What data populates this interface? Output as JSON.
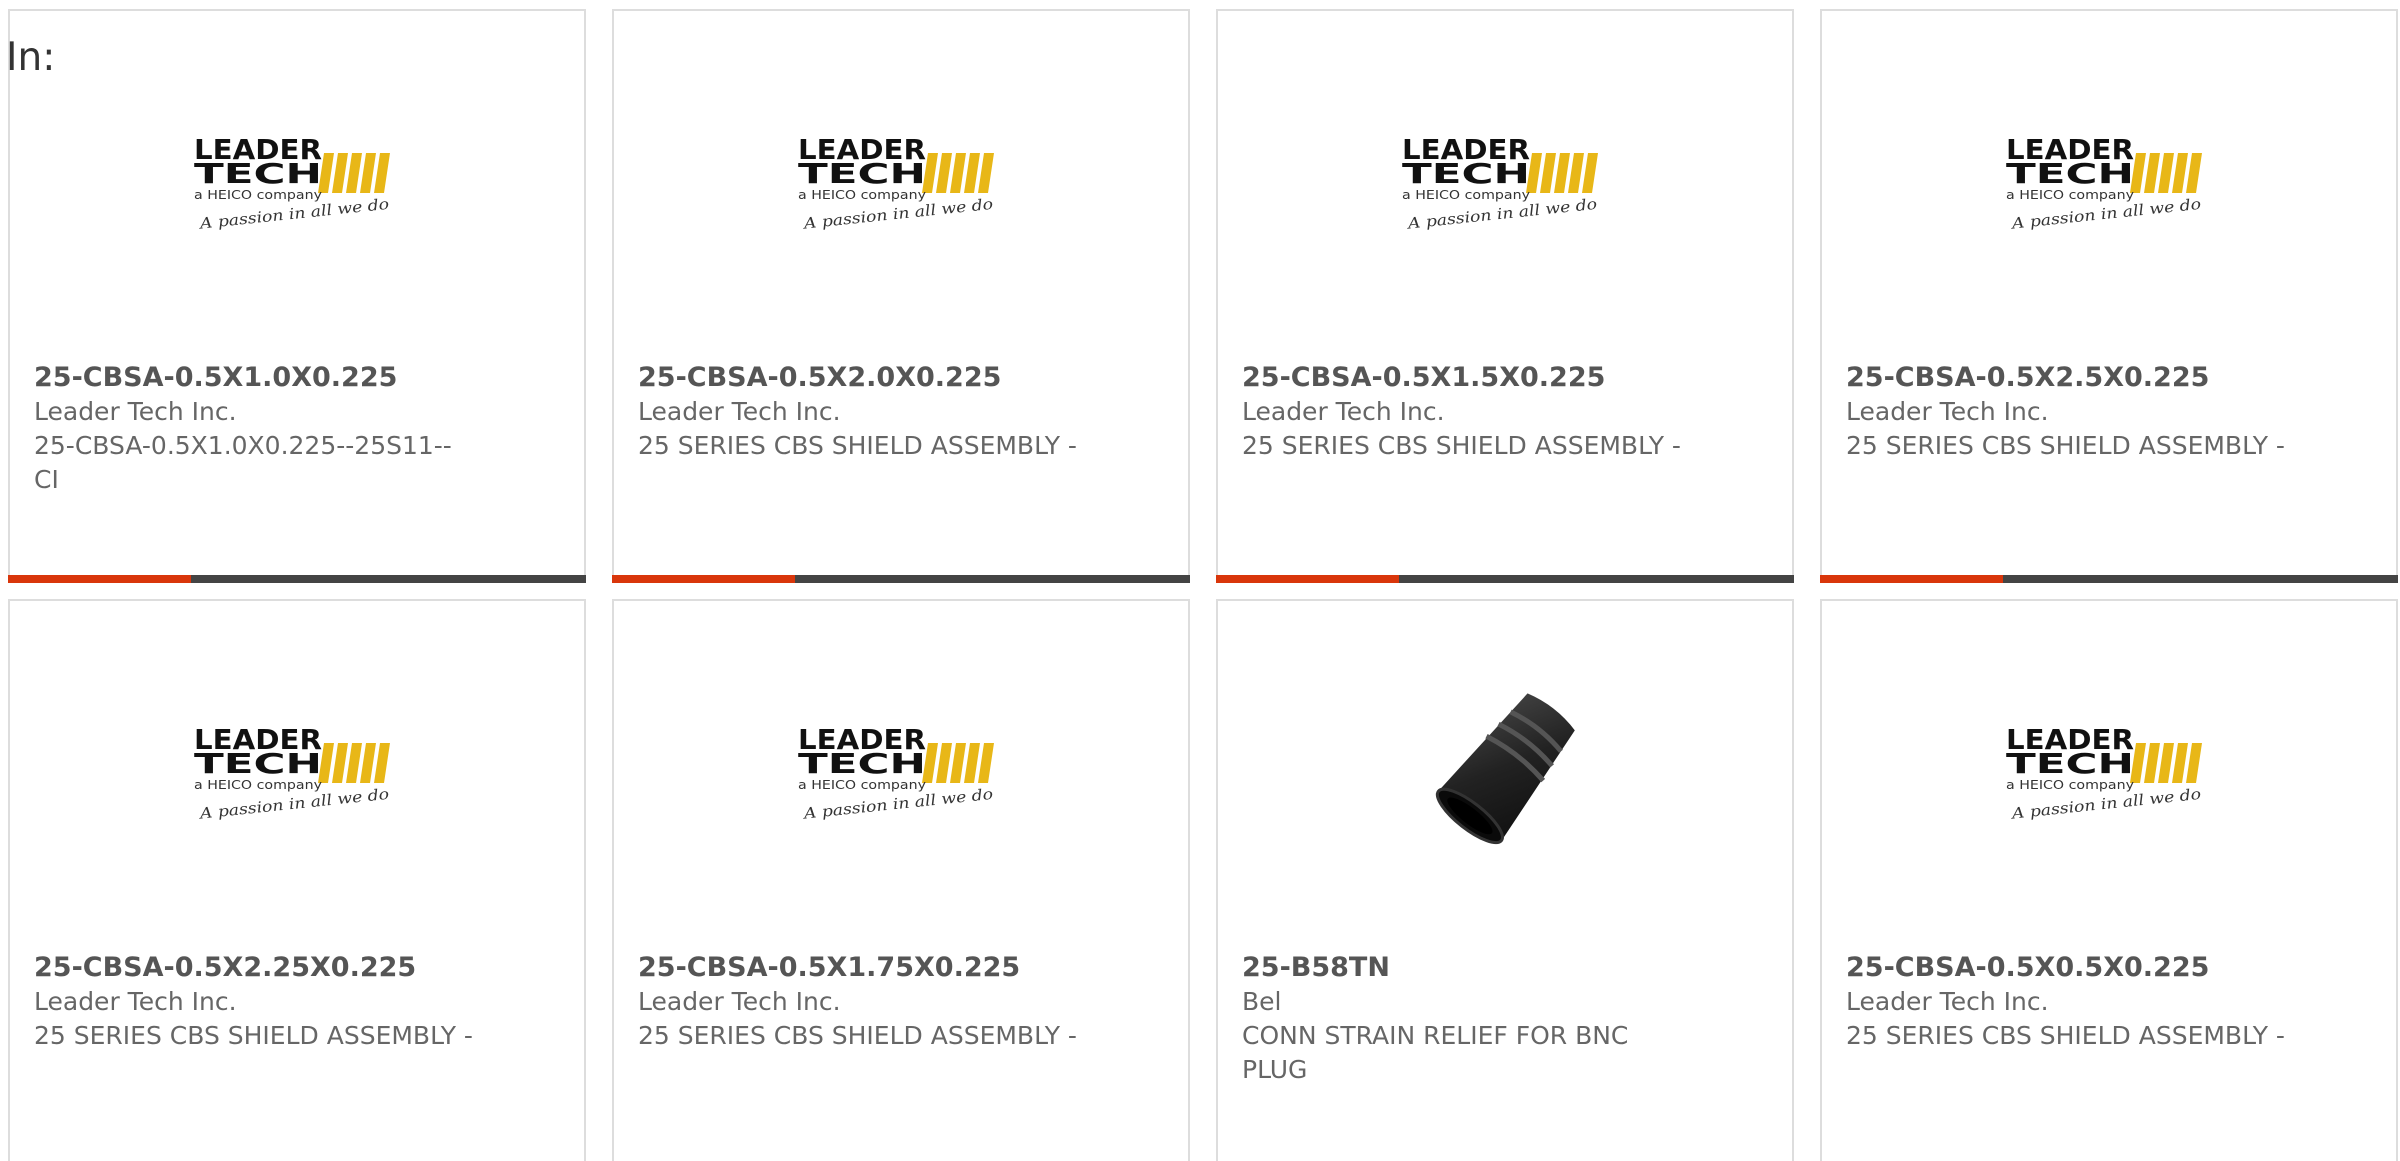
{
  "page": {
    "in_label": "In:"
  },
  "colors": {
    "accent": "#d9360b",
    "bar": "#444444",
    "logo_yellow": "#e8b717",
    "text": "#666666"
  },
  "products": [
    {
      "part_number": "25-CBSA-0.5X1.0X0.225",
      "manufacturer": "Leader Tech Inc.",
      "description": "25-CBSA-0.5X1.0X0.225--25S11--CI",
      "image": "leader-tech-logo",
      "logo": {
        "line1": "LEADER",
        "line2": "TECH",
        "line3": "a HEICO company",
        "tagline": "A passion in all we do"
      }
    },
    {
      "part_number": "25-CBSA-0.5X2.0X0.225",
      "manufacturer": "Leader Tech Inc.",
      "description": "25 SERIES CBS SHIELD ASSEMBLY -",
      "image": "leader-tech-logo",
      "logo": {
        "line1": "LEADER",
        "line2": "TECH",
        "line3": "a HEICO company",
        "tagline": "A passion in all we do"
      }
    },
    {
      "part_number": "25-CBSA-0.5X1.5X0.225",
      "manufacturer": "Leader Tech Inc.",
      "description": "25 SERIES CBS SHIELD ASSEMBLY -",
      "image": "leader-tech-logo",
      "logo": {
        "line1": "LEADER",
        "line2": "TECH",
        "line3": "a HEICO company",
        "tagline": "A passion in all we do"
      }
    },
    {
      "part_number": "25-CBSA-0.5X2.5X0.225",
      "manufacturer": "Leader Tech Inc.",
      "description": "25 SERIES CBS SHIELD ASSEMBLY -",
      "image": "leader-tech-logo",
      "logo": {
        "line1": "LEADER",
        "line2": "TECH",
        "line3": "a HEICO company",
        "tagline": "A passion in all we do"
      }
    },
    {
      "part_number": "25-CBSA-0.5X2.25X0.225",
      "manufacturer": "Leader Tech Inc.",
      "description": "25 SERIES CBS SHIELD ASSEMBLY -",
      "image": "leader-tech-logo",
      "logo": {
        "line1": "LEADER",
        "line2": "TECH",
        "line3": "a HEICO company",
        "tagline": "A passion in all we do"
      }
    },
    {
      "part_number": "25-CBSA-0.5X1.75X0.225",
      "manufacturer": "Leader Tech Inc.",
      "description": "25 SERIES CBS SHIELD ASSEMBLY -",
      "image": "leader-tech-logo",
      "logo": {
        "line1": "LEADER",
        "line2": "TECH",
        "line3": "a HEICO company",
        "tagline": "A passion in all we do"
      }
    },
    {
      "part_number": "25-B58TN",
      "manufacturer": "Bel",
      "description": "CONN STRAIN RELIEF FOR BNC PLUG",
      "image": "strain-relief-boot-photo"
    },
    {
      "part_number": "25-CBSA-0.5X0.5X0.225",
      "manufacturer": "Leader Tech Inc.",
      "description": "25 SERIES CBS SHIELD ASSEMBLY -",
      "image": "leader-tech-logo",
      "logo": {
        "line1": "LEADER",
        "line2": "TECH",
        "line3": "a HEICO company",
        "tagline": "A passion in all we do"
      }
    }
  ]
}
